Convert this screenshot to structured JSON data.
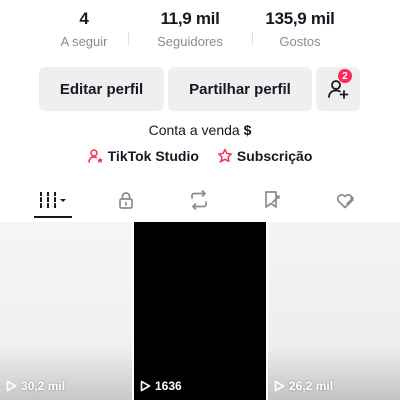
{
  "stats": [
    {
      "value": "4",
      "label": "A seguir"
    },
    {
      "value": "11,9 mil",
      "label": "Seguidores"
    },
    {
      "value": "135,9 mil",
      "label": "Gostos"
    }
  ],
  "actions": {
    "edit_label": "Editar perfil",
    "share_label": "Partilhar perfil",
    "friends_badge": "2"
  },
  "bio": {
    "text": "Conta a venda",
    "icon": "dollar-sign"
  },
  "links": [
    {
      "label": "TikTok Studio",
      "icon": "person-star-icon"
    },
    {
      "label": "Subscrição",
      "icon": "star-shield-icon"
    }
  ],
  "tabs": [
    {
      "name": "videos-grid",
      "icon": "grid-icon",
      "active": true
    },
    {
      "name": "private",
      "icon": "lock-icon",
      "active": false
    },
    {
      "name": "reposts",
      "icon": "repost-icon",
      "active": false
    },
    {
      "name": "favorites",
      "icon": "bookmark-icon",
      "active": false
    },
    {
      "name": "liked",
      "icon": "heart-icon",
      "active": false
    }
  ],
  "videos": [
    {
      "views": "30,2 mil"
    },
    {
      "views": "1636"
    },
    {
      "views": "26,2 mil"
    }
  ],
  "colors": {
    "accent": "#fe2c55",
    "text": "#161823",
    "muted": "#8a8b91",
    "button_bg": "#efeff0"
  }
}
